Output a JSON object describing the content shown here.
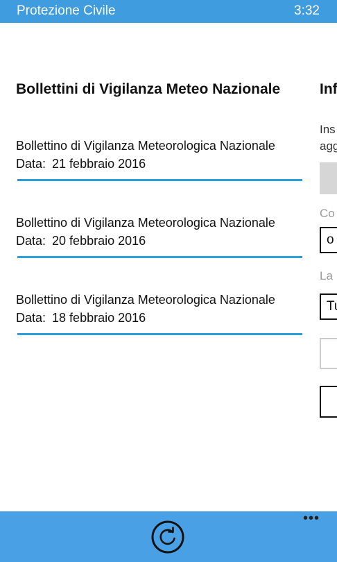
{
  "status_bar": {
    "app_name": "Protezione Civile",
    "time": "3:32"
  },
  "section": {
    "title": "Bollettini di Vigilanza Meteo Nazionale"
  },
  "bulletins": [
    {
      "name": "Bollettino di Vigilanza Meteorologica Nazionale",
      "date_label": "Data:",
      "date": "21 febbraio 2016"
    },
    {
      "name": "Bollettino di Vigilanza Meteorologica Nazionale",
      "date_label": "Data:",
      "date": "20 febbraio 2016"
    },
    {
      "name": "Bollettino di Vigilanza Meteorologica Nazionale",
      "date_label": "Data:",
      "date": "18 febbraio 2016"
    }
  ],
  "peek_section": {
    "title": "Inf",
    "intro_line1": "Ins",
    "intro_line2": "agg",
    "label1": "Co",
    "field1_value": "o",
    "label2": "La",
    "field2_value": "Tu"
  },
  "app_bar": {
    "more_label": "•••",
    "refresh_icon": "refresh-icon"
  },
  "colors": {
    "status_bar": "#3e9cdf",
    "app_bar": "#4aa0e5",
    "accent_line": "#2aa0d8"
  }
}
